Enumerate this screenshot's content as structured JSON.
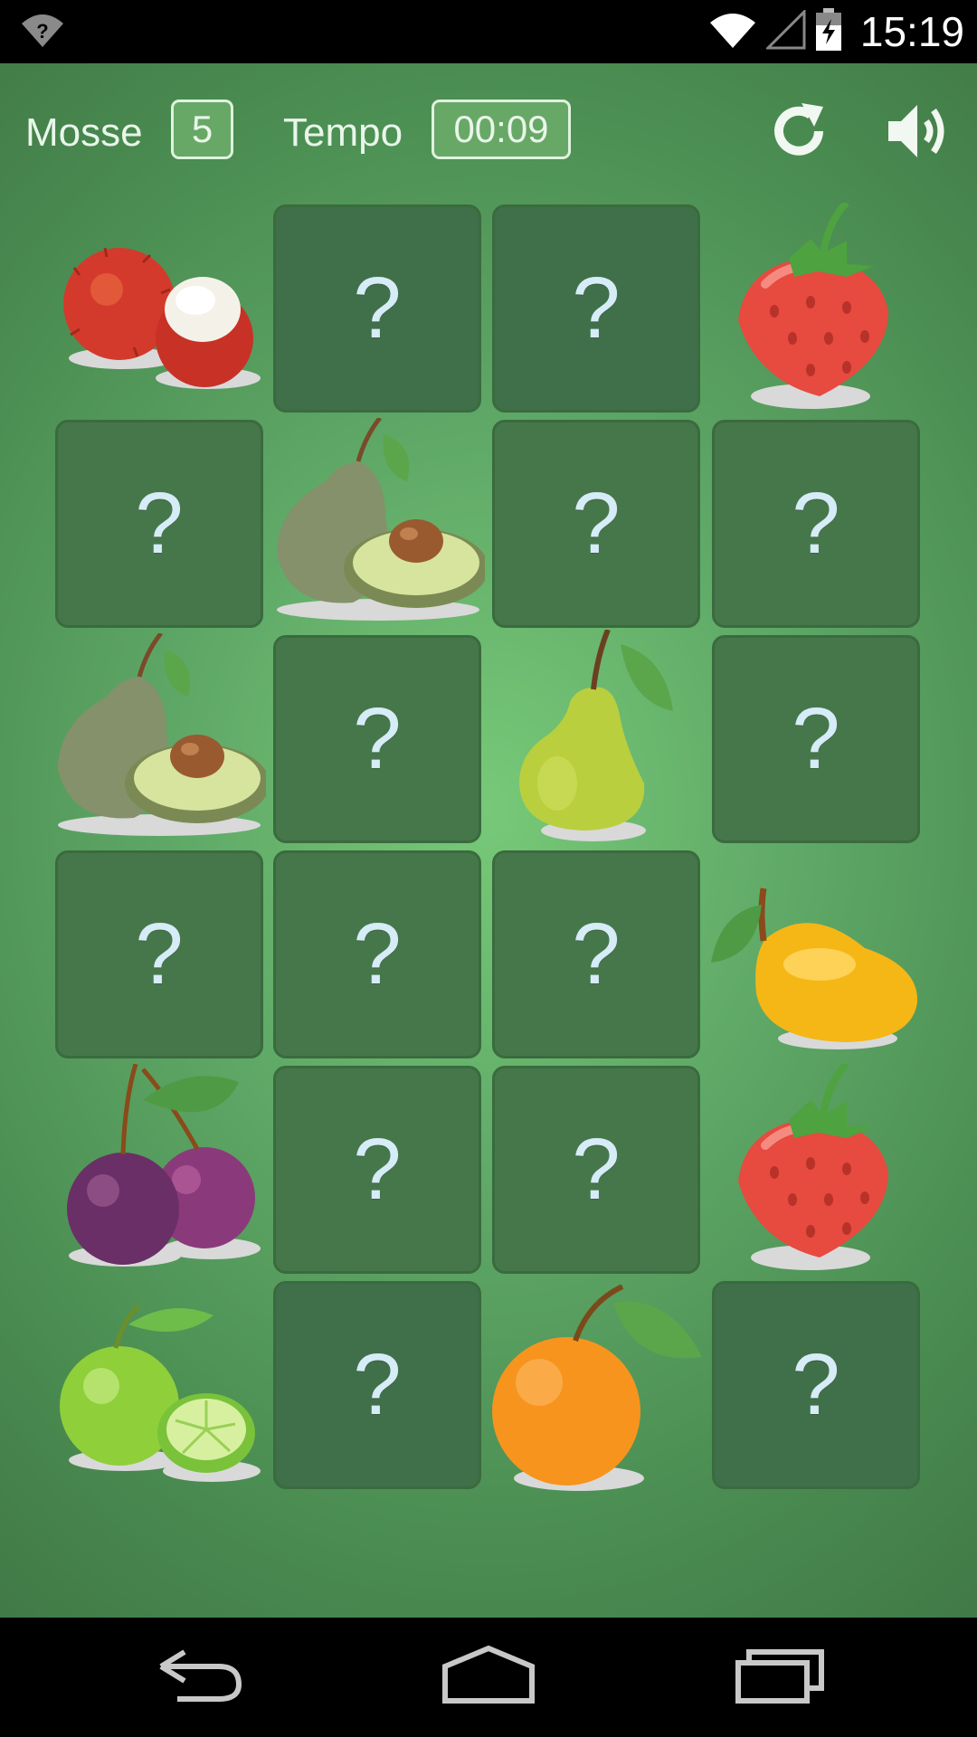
{
  "status_bar": {
    "time": "15:19",
    "icons": [
      "wifi-question-icon",
      "wifi-icon",
      "signal-icon",
      "battery-charging-icon"
    ]
  },
  "hud": {
    "moves_label": "Mosse",
    "moves_value": "5",
    "time_label": "Tempo",
    "time_value": "00:09",
    "icons": [
      "restart-icon",
      "volume-icon"
    ]
  },
  "board": {
    "rows": 6,
    "cols": 4,
    "hidden_symbol": "?",
    "tiles": [
      "rambutan",
      "hidden",
      "hidden",
      "strawberry",
      "hidden",
      "avocado",
      "hidden",
      "hidden",
      "avocado",
      "hidden",
      "pear",
      "hidden",
      "hidden",
      "hidden",
      "hidden",
      "mango",
      "plum",
      "hidden",
      "hidden",
      "strawberry",
      "lime",
      "hidden",
      "orange",
      "hidden"
    ]
  },
  "nav_bar": {
    "icons": [
      "back-icon",
      "home-icon",
      "recent-apps-icon"
    ]
  }
}
